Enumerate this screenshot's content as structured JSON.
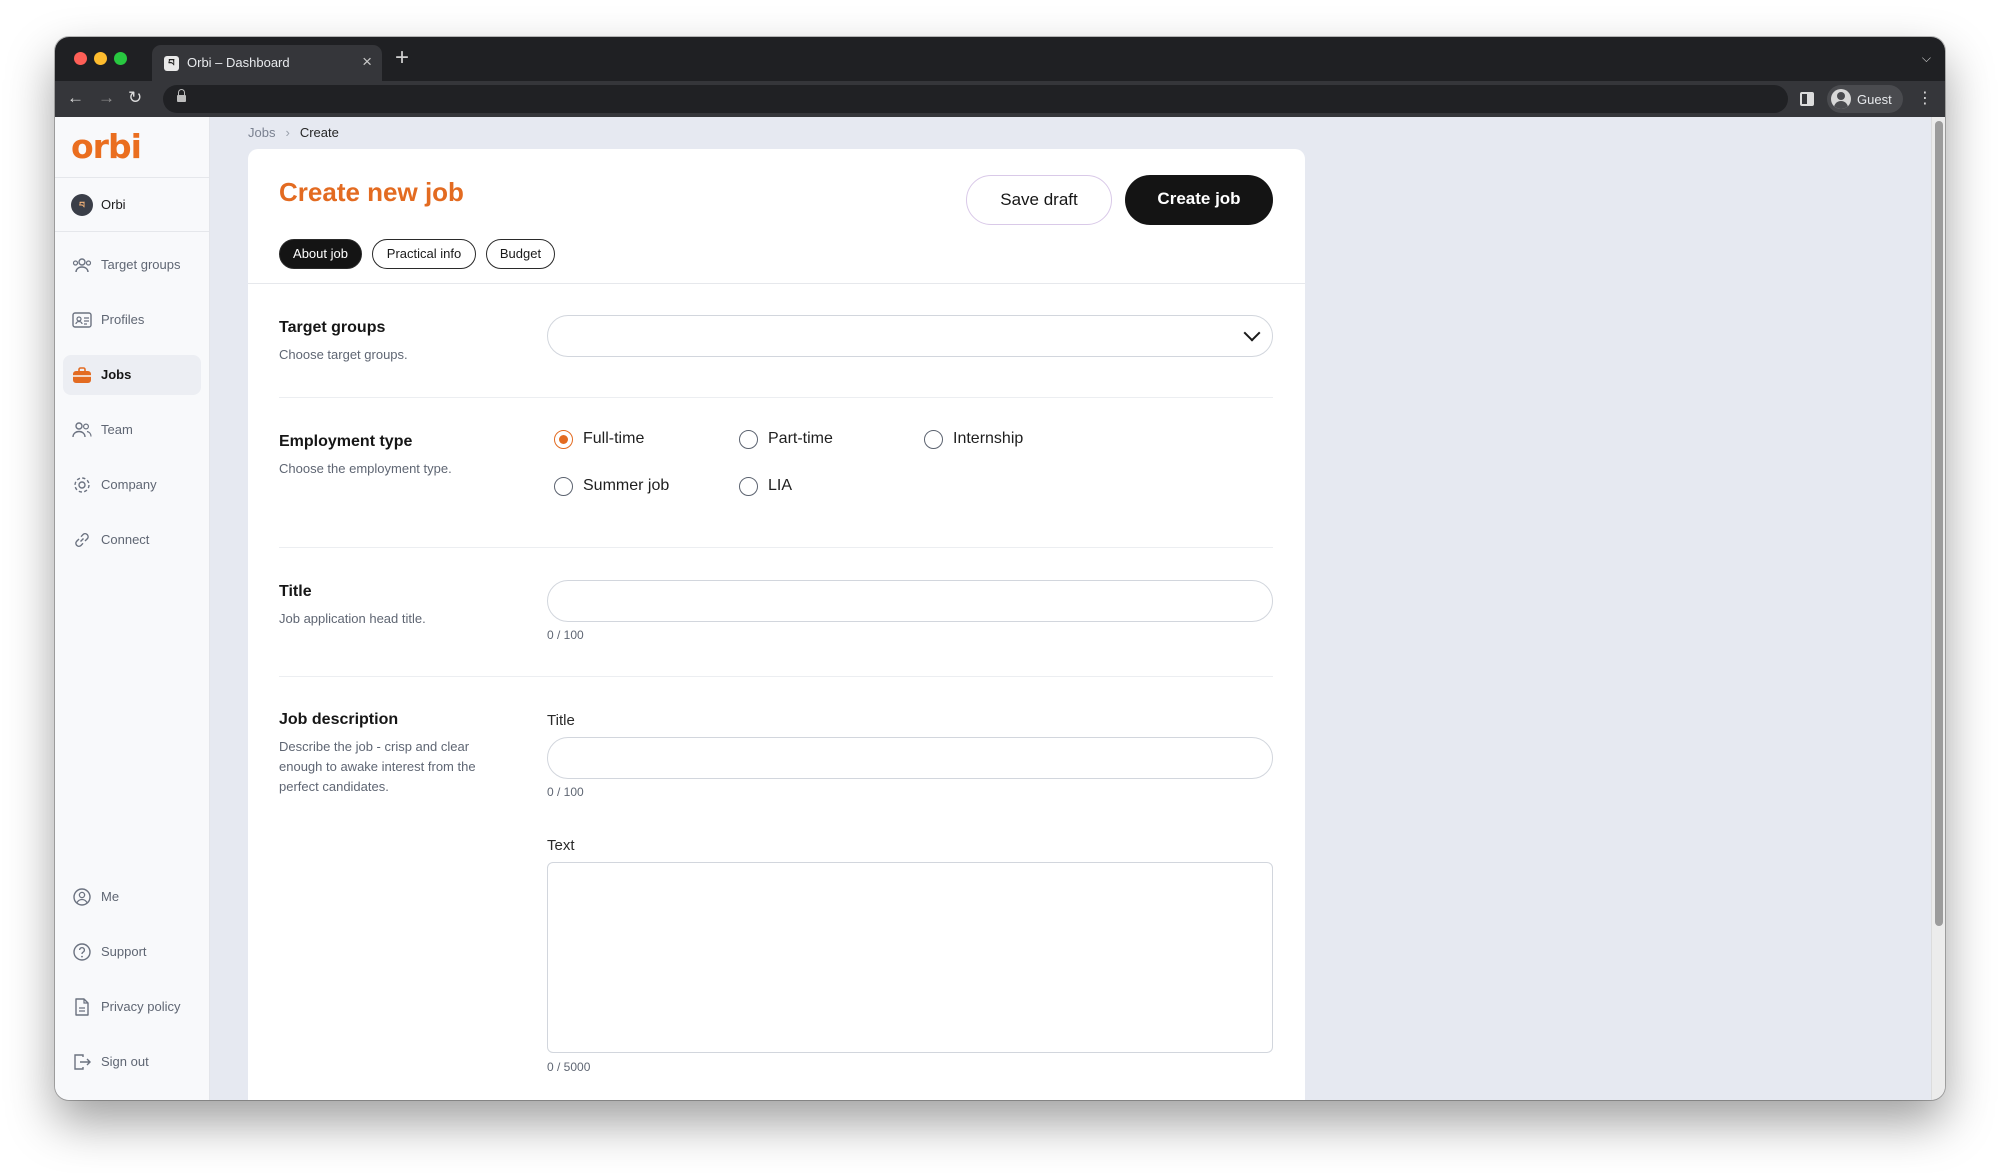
{
  "browser": {
    "tab_title": "Orbi – Dashboard",
    "tab_favicon": "བ",
    "profile_label": "Guest"
  },
  "app": {
    "logo": "orbi",
    "org_name": "Orbi",
    "org_avatar": "བ",
    "brand_color": "#e36b21"
  },
  "sidebar": {
    "items": [
      {
        "label": "Target groups",
        "icon": "users-group-icon"
      },
      {
        "label": "Profiles",
        "icon": "id-card-icon"
      },
      {
        "label": "Jobs",
        "icon": "briefcase-icon",
        "active": true
      },
      {
        "label": "Team",
        "icon": "team-icon"
      },
      {
        "label": "Company",
        "icon": "gear-icon"
      },
      {
        "label": "Connect",
        "icon": "link-icon"
      }
    ],
    "bottom_items": [
      {
        "label": "Me",
        "icon": "user-circle-icon"
      },
      {
        "label": "Support",
        "icon": "help-circle-icon"
      },
      {
        "label": "Privacy policy",
        "icon": "document-icon"
      },
      {
        "label": "Sign out",
        "icon": "sign-out-icon"
      }
    ]
  },
  "breadcrumb": {
    "parent": "Jobs",
    "current": "Create"
  },
  "page": {
    "title": "Create new job",
    "save_draft_label": "Save draft",
    "create_job_label": "Create job",
    "tabs": [
      {
        "label": "About job",
        "active": true
      },
      {
        "label": "Practical info",
        "active": false
      },
      {
        "label": "Budget",
        "active": false
      }
    ]
  },
  "form": {
    "target_groups": {
      "title": "Target groups",
      "description": "Choose target groups.",
      "value": ""
    },
    "employment_type": {
      "title": "Employment type",
      "description": "Choose the employment type.",
      "options": [
        {
          "label": "Full-time",
          "checked": true
        },
        {
          "label": "Part-time",
          "checked": false
        },
        {
          "label": "Internship",
          "checked": false
        },
        {
          "label": "Summer job",
          "checked": false
        },
        {
          "label": "LIA",
          "checked": false
        }
      ]
    },
    "title_field": {
      "title": "Title",
      "description": "Job application head title.",
      "value": "",
      "counter": "0 / 100"
    },
    "job_description": {
      "title": "Job description",
      "description": "Describe the job - crisp and clear enough to awake interest from the perfect candidates.",
      "sub_title_label": "Title",
      "sub_title_value": "",
      "sub_title_counter": "0 / 100",
      "text_label": "Text",
      "text_value": "",
      "text_counter": "0 / 5000"
    }
  }
}
